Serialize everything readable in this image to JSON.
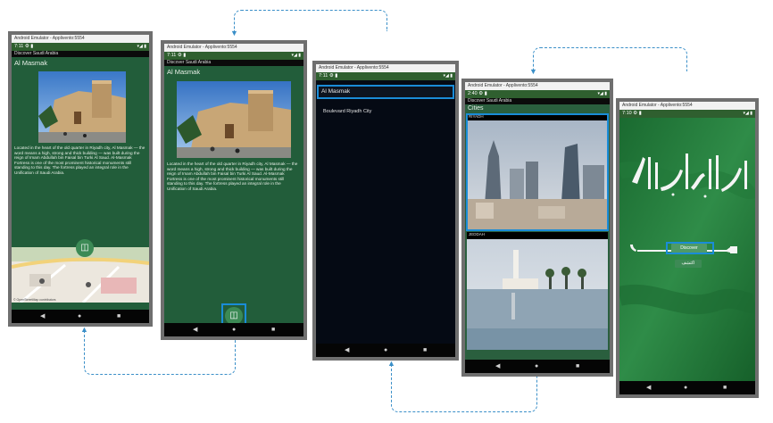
{
  "common": {
    "window_title": "Android Emulator - Applivento:5554",
    "app_name": "Discover Saudi Arabia",
    "status_right": "▾◢ ▮",
    "nav_back": "◀",
    "nav_home": "●",
    "nav_recent": "■"
  },
  "screen1": {
    "time": "7:11",
    "status_icons": "⚙ ▮",
    "heading": "Al Masmak",
    "description": "Located in the heart of the old quarter in Riyadh city, Al Masmak — the word means a high, strong and thick building — was built during the reign of Imam Abdullah bin Faisal bin Turki Al Saud. Al-Masmak Fortress is one of the most prominent historical monuments still standing to this day. The fortress played an integral role in the Unification of Saudi Arabia.",
    "map_credit": "© OpenStreetMap contributors",
    "fab_icon": "map-icon"
  },
  "screen2": {
    "time": "7:11",
    "status_icons": "⚙ ▮",
    "heading": "Al Masmak",
    "description": "Located in the heart of the old quarter in Riyadh city, Al Masmak — the word means a high, strong and thick building — was built during the reign of Imam Abdullah bin Faisal bin Turki Al Saud. Al-Masmak Fortress is one of the most prominent historical monuments still standing to this day. The fortress played an integral role in the Unification of Saudi Arabia.",
    "fab_icon": "map-icon"
  },
  "screen3": {
    "time": "7:11",
    "status_icons": "⚙ ▮",
    "items": [
      "Al Masmak",
      "Boulevard Riyadh City"
    ]
  },
  "screen4": {
    "time": "2:40",
    "status_icons": "⚙ ▮",
    "heading": "Cities",
    "cities": [
      "RIYADH",
      "JEDDAH"
    ]
  },
  "screen5": {
    "time": "7:10",
    "status_icons": "⚙ ▮",
    "discover_label": "Discover",
    "arabic_label": "اكتشف"
  },
  "colors": {
    "accent": "#1a8cd8",
    "app_green": "#2d6b45",
    "status_green": "#2f5f2f"
  }
}
